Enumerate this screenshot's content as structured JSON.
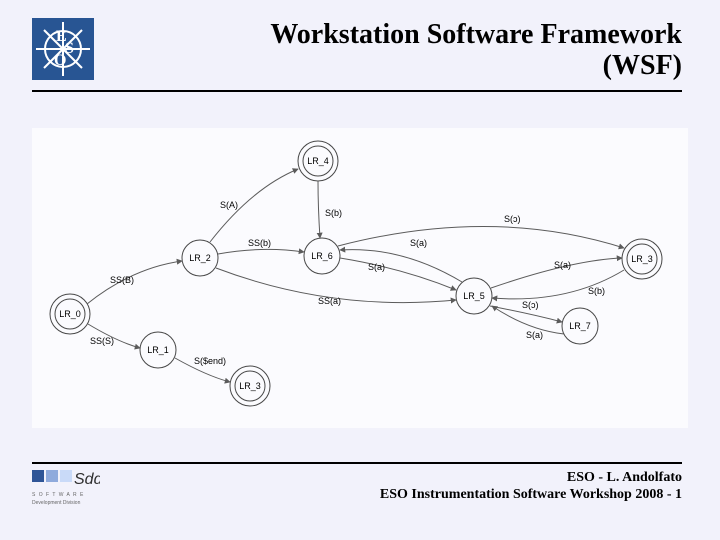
{
  "header": {
    "title_line1": "Workstation Software Framework",
    "title_line2": "(WSF)",
    "logo_letters": "ESO"
  },
  "footer": {
    "credit_line1": "ESO - L. Andolfato",
    "credit_line2": "ESO Instrumentation Software Workshop 2008 - 1",
    "sdd_text": "Sdd",
    "sdd_sub1": "S O F T W A R E",
    "sdd_sub2": "Development Division"
  },
  "diagram": {
    "nodes": {
      "LR_0": "LR_0",
      "LR_1": "LR_1",
      "LR_2": "LR_2",
      "LR_3_left": "LR_3",
      "LR_3_right": "LR_3",
      "LR_4": "LR_4",
      "LR_5": "LR_5",
      "LR_6": "LR_6",
      "LR_7": "LR_7"
    },
    "edges": {
      "SS_B": "SS(B)",
      "SS_S": "SS(S)",
      "S_end": "S($end)",
      "S_A": "S(A)",
      "SS_b": "SS(b)",
      "SS_a": "SS(a)",
      "S_b_mid": "S(b)",
      "S_a_mid": "S(a)",
      "S_a_r1": "S(a)",
      "S_a_r2": "S(a)",
      "S_a_r3": "S(a)",
      "S_b_r": "S(b)",
      "S_o_top": "S(ɔ)",
      "S_o_r1": "S(ɔ)"
    }
  }
}
